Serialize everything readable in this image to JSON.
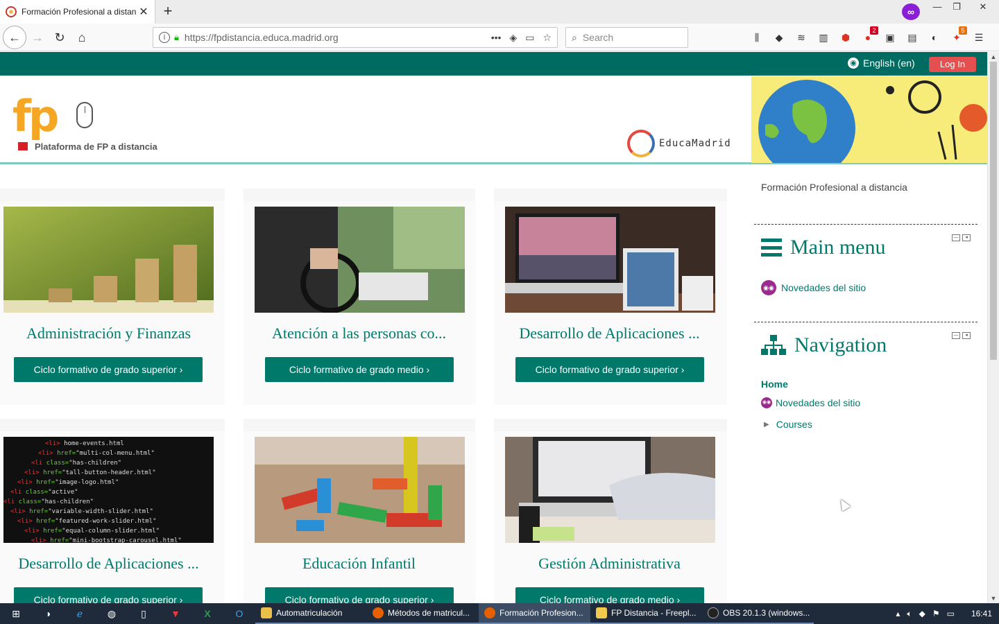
{
  "browser": {
    "tab_title": "Formación Profesional a distan",
    "tab_close": "✕",
    "new_tab": "+",
    "url": "https://fpdistancia.educa.madrid.org",
    "search_placeholder": "Search",
    "badges": {
      "notify": "2",
      "ext": "5"
    }
  },
  "site": {
    "language": "English (en)",
    "login": "Log In",
    "logo_text": "Plataforma de FP a distancia",
    "educamadrid": "EducaMadrid",
    "site_name": "Formación Profesional a distancia"
  },
  "courses": [
    {
      "name": "Administración y Finanzas",
      "button": "Ciclo formativo de grado superior ›",
      "image": "coin-stacks"
    },
    {
      "name": "Atención a las personas co...",
      "button": "Ciclo formativo de grado medio ›",
      "image": "wheelchair"
    },
    {
      "name": "Desarrollo de Aplicaciones ...",
      "button": "Ciclo formativo de grado superior ›",
      "image": "laptop-tablet"
    },
    {
      "name": "Desarrollo de Aplicaciones ...",
      "button": "Ciclo formativo de grado superior ›",
      "image": "code-screen"
    },
    {
      "name": "Educación Infantil",
      "button": "Ciclo formativo de grado superior ›",
      "image": "toy-blocks"
    },
    {
      "name": "Gestión Administrativa",
      "button": "Ciclo formativo de grado medio ›",
      "image": "typing-laptop"
    }
  ],
  "sidebar": {
    "main_menu": {
      "title": "Main menu",
      "items": [
        "Novedades del sitio"
      ]
    },
    "navigation": {
      "title": "Navigation",
      "home": "Home",
      "site_news": "Novedades del sitio",
      "courses": "Courses"
    }
  },
  "taskbar": {
    "apps": [
      "Automatriculación",
      "Métodos de matricul...",
      "Formación Profesion...",
      "FP Distancia - Freepl...",
      "OBS 20.1.3 (windows..."
    ],
    "clock": "16:41"
  },
  "colors": {
    "brand": "#00796b",
    "topbar": "#006b61",
    "login": "#e45050"
  }
}
